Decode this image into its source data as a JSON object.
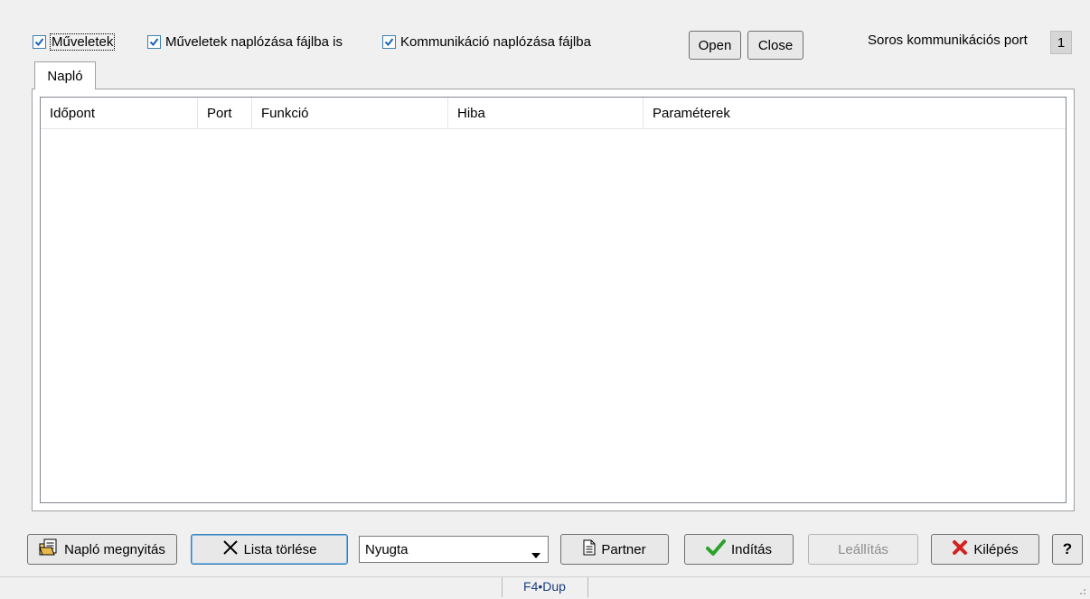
{
  "options": {
    "muveletek": {
      "label": "Műveletek",
      "checked": true
    },
    "muveletek_fajlba": {
      "label": "Műveletek naplózása fájlba is",
      "checked": true
    },
    "kommunikacio_fajlba": {
      "label": "Kommunikáció naplózása fájlba",
      "checked": true
    }
  },
  "port": {
    "open_label": "Open",
    "close_label": "Close",
    "serial_label": "Soros kommunikációs port",
    "serial_value": "1"
  },
  "tabs": [
    {
      "label": "Napló",
      "active": true
    }
  ],
  "log_table": {
    "columns": [
      "Időpont",
      "Port",
      "Funkció",
      "Hiba",
      "Paraméterek"
    ],
    "rows": []
  },
  "toolbar": {
    "open_log_label": "Napló megnyitás",
    "clear_list_label": "Lista törlése",
    "document_type_value": "Nyugta",
    "partner_label": "Partner",
    "start_label": "Indítás",
    "stop_label": "Leállítás",
    "exit_label": "Kilépés",
    "help_label": "?"
  },
  "status": {
    "shortcut_text": "F4•Dup"
  },
  "colors": {
    "accent": "#3c7fb1",
    "check": "#1a62b4",
    "start_check": "#2aa12a",
    "exit_x": "#d42020"
  }
}
